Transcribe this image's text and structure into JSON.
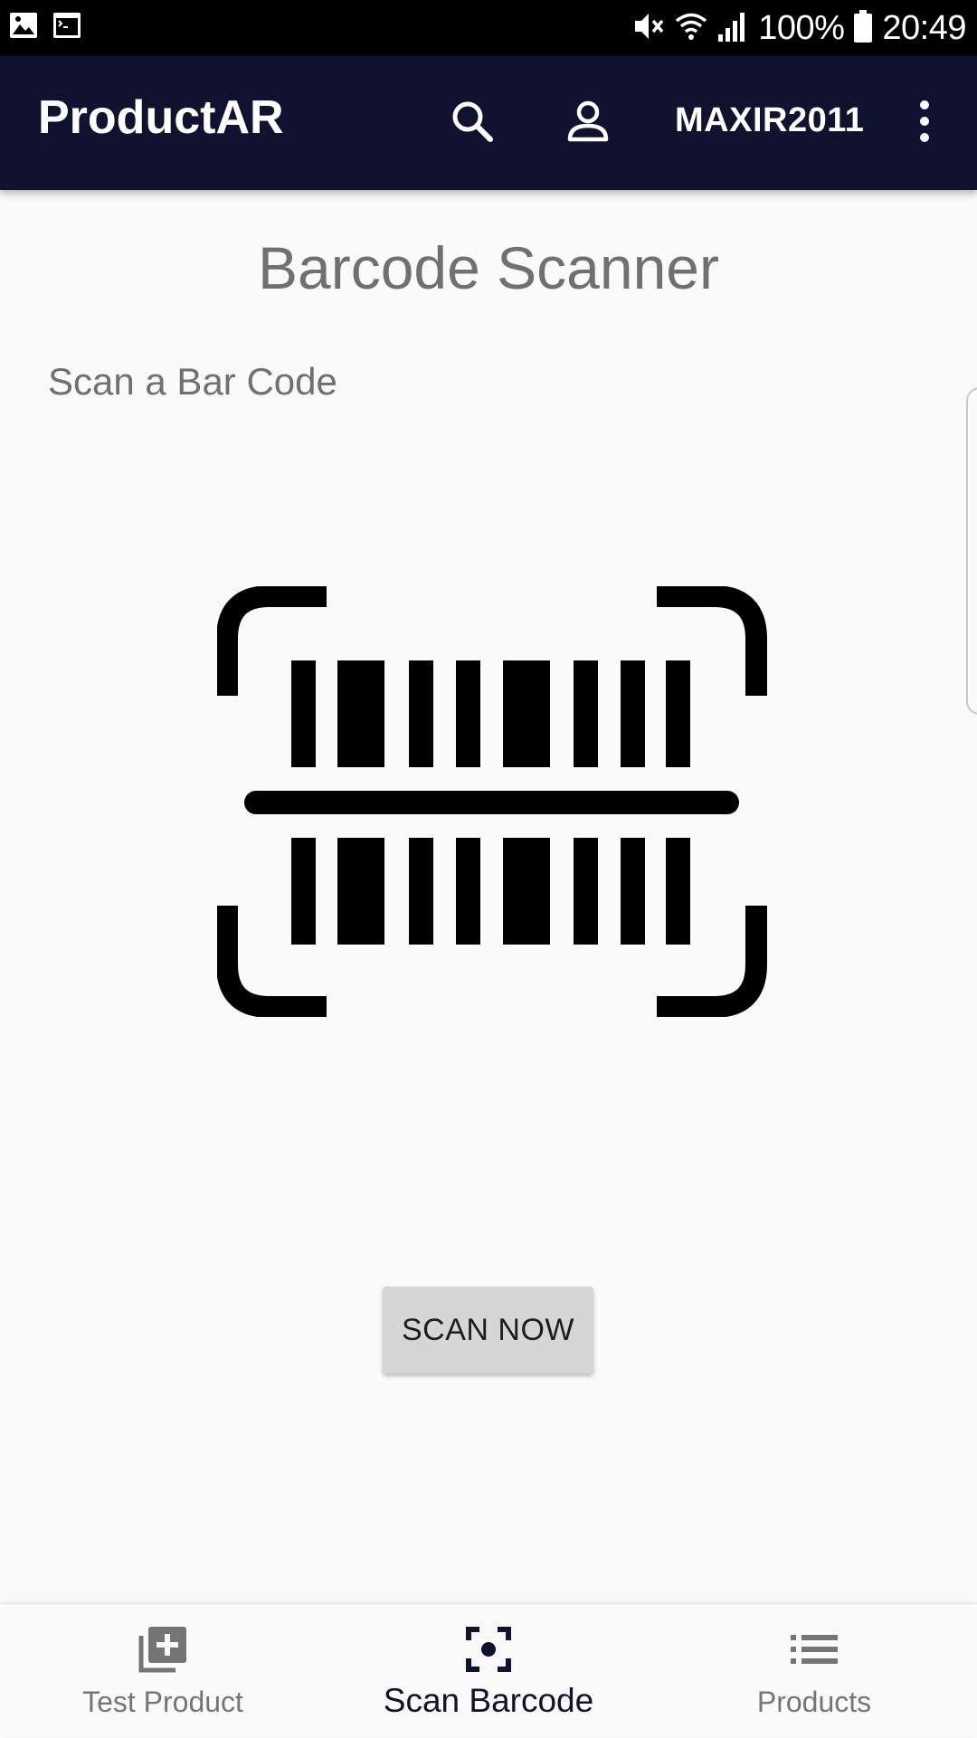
{
  "status_bar": {
    "battery_percent": "100%",
    "time": "20:49",
    "icons": [
      "gallery-icon",
      "terminal-icon",
      "mute-icon",
      "wifi-icon",
      "signal-icon",
      "battery-icon"
    ]
  },
  "app_bar": {
    "title": "ProductAR",
    "username": "MAXIR2011",
    "actions": [
      "search-icon",
      "account-icon",
      "more-vert-icon"
    ],
    "background_color": "#10122f"
  },
  "main": {
    "title": "Barcode Scanner",
    "subtitle": "Scan a Bar Code",
    "illustration": "barcode-scan-icon",
    "scan_button_label": "SCAN NOW"
  },
  "bottom_nav": {
    "items": [
      {
        "label": "Test Product",
        "icon": "add-to-library-icon",
        "active": false
      },
      {
        "label": "Scan Barcode",
        "icon": "center-focus-icon",
        "active": true
      },
      {
        "label": "Products",
        "icon": "list-icon",
        "active": false
      }
    ],
    "active_color": "#10122f",
    "inactive_color": "#757575"
  }
}
